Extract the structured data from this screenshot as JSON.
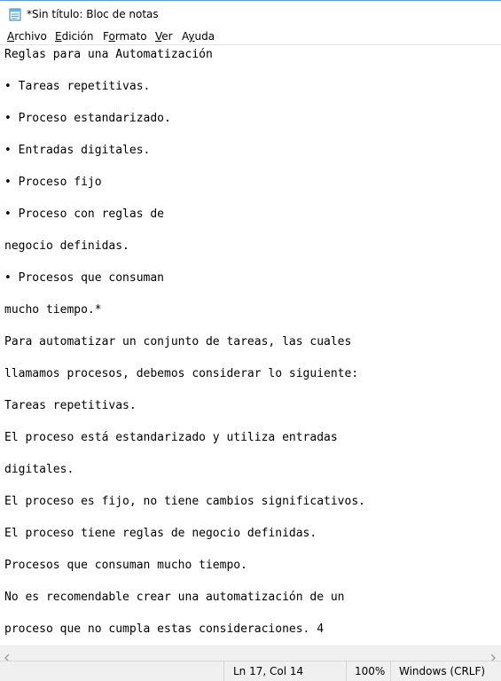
{
  "window": {
    "title": "*Sin título: Bloc de notas",
    "icon": "notepad-icon"
  },
  "menu": {
    "items": [
      {
        "label": "Archivo",
        "accelerator": "A",
        "rest": "rchivo"
      },
      {
        "label": "Edición",
        "accelerator": "E",
        "rest": "dición"
      },
      {
        "label": "Formato",
        "accelerator": "o",
        "pre": "F",
        "rest": "rmato"
      },
      {
        "label": "Ver",
        "accelerator": "V",
        "rest": "er"
      },
      {
        "label": "Ayuda",
        "accelerator": "y",
        "pre": "A",
        "rest": "uda"
      }
    ]
  },
  "document": {
    "lines": [
      "Reglas para una Automatización",
      "• Tareas repetitivas.",
      "• Proceso estandarizado.",
      "• Entradas digitales.",
      "• Proceso fijo",
      "• Proceso con reglas de",
      "negocio definidas.",
      "• Procesos que consuman",
      "mucho tiempo.*",
      "Para automatizar un conjunto de tareas, las cuales",
      "llamamos procesos, debemos considerar lo siguiente:",
      "Tareas repetitivas.",
      "El proceso está estandarizado y utiliza entradas",
      "digitales.",
      "El proceso es fijo, no tiene cambios significativos.",
      "El proceso tiene reglas de negocio definidas.",
      "Procesos que consuman mucho tiempo.",
      "No es recomendable crear una automatización de un",
      "proceso que no cumpla estas consideraciones. 4"
    ]
  },
  "statusbar": {
    "position": "Ln 17, Col 14",
    "zoom": "100%",
    "line_endings": "Windows (CRLF)"
  }
}
